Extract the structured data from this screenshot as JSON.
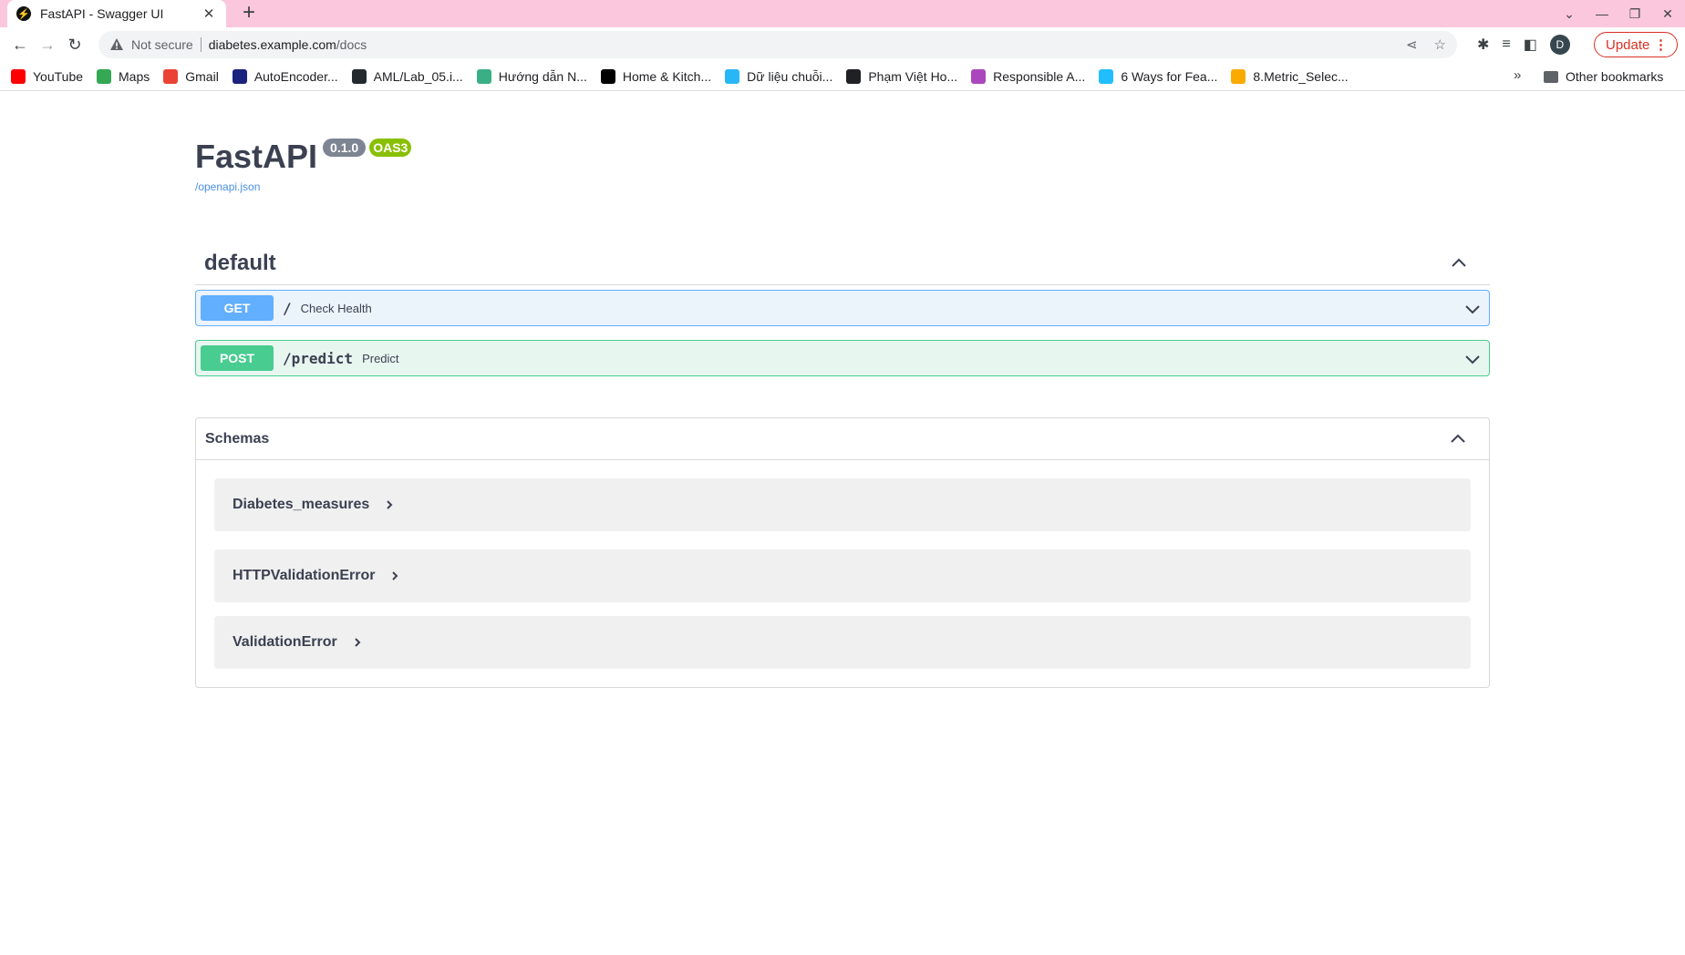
{
  "browser": {
    "tab_title": "FastAPI - Swagger UI",
    "tab_favicon": "⚡",
    "new_tab": "+",
    "not_secure": "Not secure",
    "url_host": "diabetes.example.com",
    "url_path": "/docs",
    "update_label": "Update",
    "avatar_letter": "D"
  },
  "bookmarks": [
    {
      "label": "YouTube",
      "icon": "youtube-icon",
      "color": "#ff0000"
    },
    {
      "label": "Maps",
      "icon": "maps-icon",
      "color": "#34a853"
    },
    {
      "label": "Gmail",
      "icon": "gmail-icon",
      "color": "#ea4335"
    },
    {
      "label": "AutoEncoder...",
      "icon": "site-icon",
      "color": "#1a237e"
    },
    {
      "label": "AML/Lab_05.i...",
      "icon": "github-icon",
      "color": "#24292e"
    },
    {
      "label": "Hướng dẫn N...",
      "icon": "site-icon",
      "color": "#3aaf85"
    },
    {
      "label": "Home & Kitch...",
      "icon": "amazon-icon",
      "color": "#000000"
    },
    {
      "label": "Dữ liệu chuỗi...",
      "icon": "site-icon",
      "color": "#29b6f6"
    },
    {
      "label": "Phạm Việt Ho...",
      "icon": "globe-icon",
      "color": "#202124"
    },
    {
      "label": "Responsible A...",
      "icon": "site-icon",
      "color": "#ab47bc"
    },
    {
      "label": "6 Ways for Fea...",
      "icon": "kaggle-icon",
      "color": "#20beff"
    },
    {
      "label": "8.Metric_Selec...",
      "icon": "colab-icon",
      "color": "#f9ab00"
    }
  ],
  "bookmarks_more": "»",
  "other_bookmarks": "Other bookmarks",
  "info": {
    "title": "FastAPI",
    "version": "0.1.0",
    "oas": "OAS3",
    "spec_link": "/openapi.json"
  },
  "tag": {
    "name": "default"
  },
  "operations": [
    {
      "method": "GET",
      "path": "/",
      "summary": "Check Health",
      "color": "#61affe"
    },
    {
      "method": "POST",
      "path": "/predict",
      "summary": "Predict",
      "color": "#49cc90"
    }
  ],
  "schemas": {
    "title": "Schemas",
    "items": [
      "Diabetes_measures",
      "HTTPValidationError",
      "ValidationError"
    ]
  }
}
